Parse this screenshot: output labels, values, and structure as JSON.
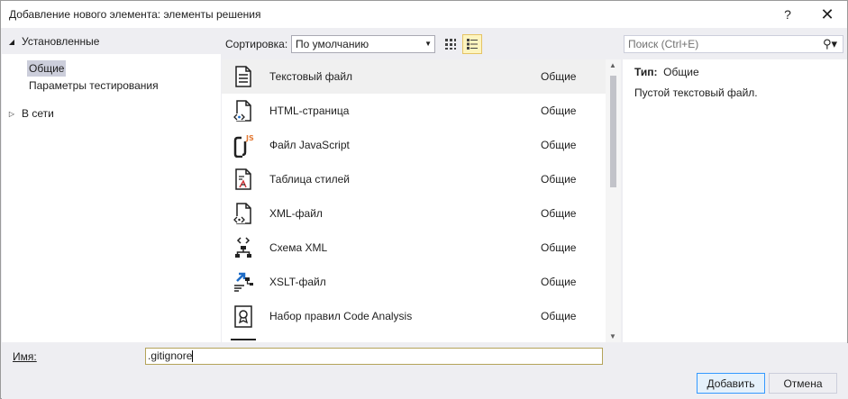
{
  "window": {
    "title": "Добавление нового элемента: элементы решения",
    "help": "?",
    "close": "✕"
  },
  "tree": {
    "installed": "Установленные",
    "items": [
      "Общие",
      "Параметры тестирования"
    ],
    "online": "В сети"
  },
  "toolbar": {
    "sort_label": "Сортировка:",
    "sort_value": "По умолчанию",
    "search_placeholder": "Поиск (Ctrl+E)"
  },
  "list": {
    "items": [
      {
        "name": "Текстовый файл",
        "category": "Общие",
        "icon": "text-file-icon"
      },
      {
        "name": "HTML-страница",
        "category": "Общие",
        "icon": "html-page-icon"
      },
      {
        "name": "Файл JavaScript",
        "category": "Общие",
        "icon": "javascript-file-icon"
      },
      {
        "name": "Таблица стилей",
        "category": "Общие",
        "icon": "stylesheet-icon"
      },
      {
        "name": "XML-файл",
        "category": "Общие",
        "icon": "xml-file-icon"
      },
      {
        "name": "Схема XML",
        "category": "Общие",
        "icon": "xml-schema-icon"
      },
      {
        "name": "XSLT-файл",
        "category": "Общие",
        "icon": "xslt-file-icon"
      },
      {
        "name": "Набор правил Code Analysis",
        "category": "Общие",
        "icon": "code-analysis-ruleset-icon"
      }
    ]
  },
  "details": {
    "type_label": "Тип:",
    "type_value": "Общие",
    "description": "Пустой текстовый файл."
  },
  "bottom": {
    "name_label": "Имя:",
    "name_value": ".gitignore",
    "add_button": "Добавить",
    "cancel_button": "Отмена"
  },
  "colors": {
    "selection": "#cccedb",
    "accent": "#3399ff",
    "js_badge": "#e37933"
  }
}
